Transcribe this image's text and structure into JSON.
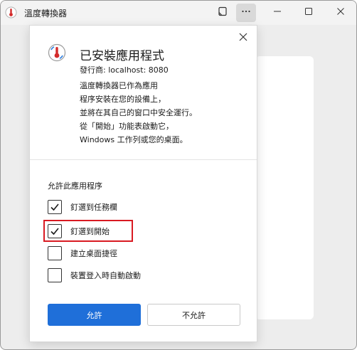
{
  "window": {
    "title": "溫度轉換器"
  },
  "dialog": {
    "title": "已安裝應用程式",
    "publisher": "發行商: localhost: 8080",
    "description_lines": [
      "溫度轉換器已作為應用",
      "程序安裝在您的設備上，",
      "並將在其自己的窗口中安全運行。",
      "從「開始」功能表啟動它，",
      "Windows 工作列或您的桌面。"
    ],
    "section_label": "允許此應用程序",
    "options": [
      {
        "label": "釘選到任務欄",
        "checked": true
      },
      {
        "label": "釘選到開始",
        "checked": true
      },
      {
        "label": "建立桌面捷徑",
        "checked": false
      },
      {
        "label": "裝置登入時自動啟動",
        "checked": false
      }
    ],
    "allow_label": "允許",
    "deny_label": "不允許"
  },
  "colors": {
    "accent": "#1f6fd9",
    "highlight": "#d91a22",
    "icon_red": "#d32b2b"
  },
  "icons": {
    "app": "thermometer-icon",
    "cast": "cast-icon",
    "more": "more-icon",
    "minimize": "minimize-icon",
    "maximize": "maximize-icon",
    "close": "close-icon",
    "check": "checkmark-icon"
  }
}
